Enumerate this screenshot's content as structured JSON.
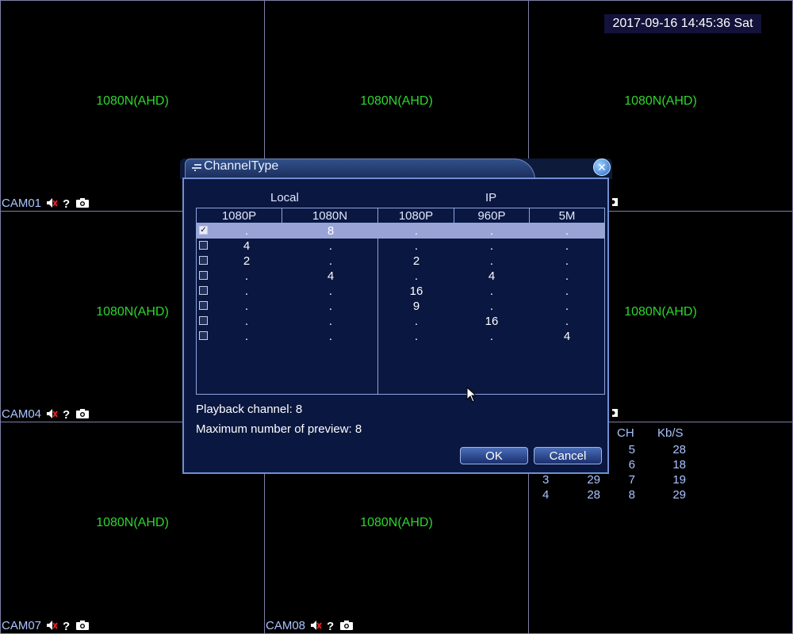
{
  "datetime": "2017-09-16 14:45:36 Sat",
  "cells": [
    {
      "res": "1080N(AHD)",
      "cam": "CAM01"
    },
    {
      "res": "1080N(AHD)",
      "cam": ""
    },
    {
      "res": "1080N(AHD)",
      "cam": ""
    },
    {
      "res": "1080N(AHD)",
      "cam": "CAM04"
    },
    {
      "res": "",
      "cam": ""
    },
    {
      "res": "1080N(AHD)",
      "cam": ""
    },
    {
      "res": "1080N(AHD)",
      "cam": "CAM07"
    },
    {
      "res": "1080N(AHD)",
      "cam": "CAM08"
    },
    {
      "res": "",
      "cam": ""
    }
  ],
  "icons": [
    "audio-muted-icon",
    "help-icon",
    "camera-snapshot-icon"
  ],
  "stats": {
    "headers": [
      "CH",
      "Kb/S"
    ],
    "rows": [
      {
        "ch_a": "",
        "kbs_a": "",
        "ch_b": "5",
        "kbs_b": "28"
      },
      {
        "ch_a": "",
        "kbs_a": "",
        "ch_b": "6",
        "kbs_b": "18"
      },
      {
        "ch_a": "3",
        "kbs_a": "29",
        "ch_b": "7",
        "kbs_b": "19"
      },
      {
        "ch_a": "4",
        "kbs_a": "28",
        "ch_b": "8",
        "kbs_b": "29"
      }
    ]
  },
  "dialog": {
    "title": "ChannelType",
    "group_local": "Local",
    "group_ip": "IP",
    "columns": [
      "1080P",
      "1080N",
      "1080P",
      "960P",
      "5M"
    ],
    "rows": [
      {
        "checked": true,
        "cells": [
          ".",
          "8",
          ".",
          ".",
          "."
        ]
      },
      {
        "checked": false,
        "cells": [
          "4",
          ".",
          ".",
          ".",
          "."
        ]
      },
      {
        "checked": false,
        "cells": [
          "2",
          ".",
          "2",
          ".",
          "."
        ]
      },
      {
        "checked": false,
        "cells": [
          ".",
          "4",
          ".",
          "4",
          "."
        ]
      },
      {
        "checked": false,
        "cells": [
          ".",
          ".",
          "16",
          ".",
          "."
        ]
      },
      {
        "checked": false,
        "cells": [
          ".",
          ".",
          "9",
          ".",
          "."
        ]
      },
      {
        "checked": false,
        "cells": [
          ".",
          ".",
          ".",
          "16",
          "."
        ]
      },
      {
        "checked": false,
        "cells": [
          ".",
          ".",
          ".",
          ".",
          "4"
        ]
      }
    ],
    "playback_label": "Playback channel: 8",
    "preview_label": "Maximum number of preview: 8",
    "ok_label": "OK",
    "cancel_label": "Cancel"
  }
}
